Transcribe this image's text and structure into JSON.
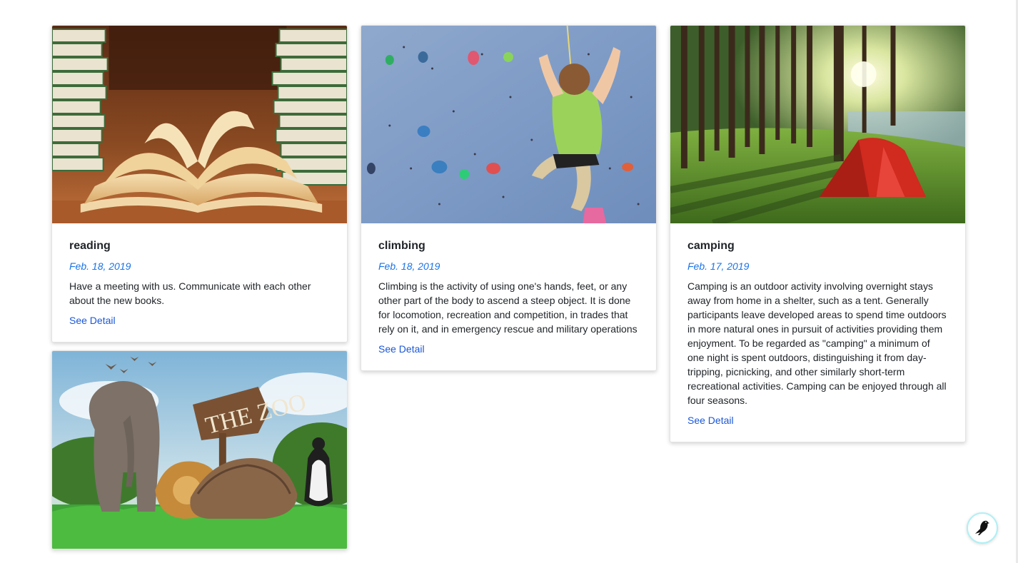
{
  "cards": [
    {
      "title": "reading",
      "date": "Feb. 18, 2019",
      "text": "Have a meeting with us. Communicate with each other about the new books.",
      "link": "See Detail",
      "image": "books-image"
    },
    {
      "title": "climbing",
      "date": "Feb. 18, 2019",
      "text": "Climbing is the activity of using one's hands, feet, or any other part of the body to ascend a steep object. It is done for locomotion, recreation and competition, in trades that rely on it, and in emergency rescue and military operations",
      "link": "See Detail",
      "image": "climbing-wall-image"
    },
    {
      "title": "camping",
      "date": "Feb. 17, 2019",
      "text": "Camping is an outdoor activity involving overnight stays away from home in a shelter, such as a tent. Generally participants leave developed areas to spend time outdoors in more natural ones in pursuit of activities providing them enjoyment. To be regarded as \"camping\" a minimum of one night is spent outdoors, distinguishing it from day-tripping, picnicking, and other similarly short-term recreational activities. Camping can be enjoyed through all four seasons.",
      "link": "See Detail",
      "image": "camping-tent-image"
    },
    {
      "image": "zoo-image",
      "sign_text": "THE ZOO"
    }
  ],
  "fab": {
    "icon": "bird-icon"
  },
  "colors": {
    "date": "#1a73e8",
    "link": "#1a57d6",
    "fab_border": "#aef0f5"
  }
}
